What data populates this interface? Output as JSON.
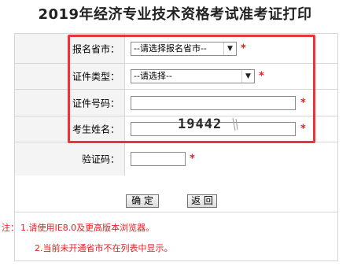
{
  "title": "2019年经济专业技术资格考试准考证打印",
  "form": {
    "province": {
      "label": "报名省市：",
      "value": "--请选择报名省市--"
    },
    "id_type": {
      "label": "证件类型：",
      "value": "--请选择--"
    },
    "id_number": {
      "label": "证件号码：",
      "value": ""
    },
    "name": {
      "label": "考生姓名：",
      "value": ""
    },
    "captcha": {
      "label": "验证码：",
      "value": "",
      "image_text": "19442"
    },
    "required_mark": "*"
  },
  "buttons": {
    "confirm": "确 定",
    "back": "返 回"
  },
  "notes": {
    "prefix": "注：",
    "item1": "1.请使用IE8.0及更高版本浏览器。",
    "item2": "2.当前未开通省市不在列表中显示。"
  },
  "colors": {
    "highlight": "#e8343a",
    "required": "#e01e1e",
    "label_bg": "#f4f4f4"
  }
}
